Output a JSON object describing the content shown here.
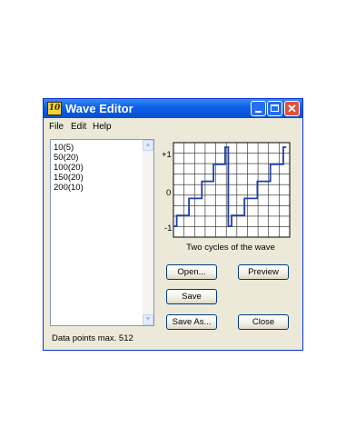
{
  "window": {
    "title": "Wave Editor",
    "app_icon": "10"
  },
  "menu": {
    "items": [
      "File",
      "Edit",
      "Help"
    ]
  },
  "list": {
    "items": [
      "10(5)",
      "50(20)",
      "100(20)",
      "150(20)",
      "200(10)"
    ]
  },
  "chart_data": {
    "type": "line",
    "title": "Two cycles of the wave",
    "y_tick_labels": [
      "+1",
      "0",
      "-1"
    ],
    "ylim": [
      -1,
      1
    ],
    "grid": true,
    "series": [
      {
        "color": "#1f3fa8",
        "x": [
          0,
          0.5,
          0.5,
          2.4,
          2.4,
          4.4,
          4.4,
          6.2,
          6.2,
          8.0,
          8.0,
          8.5,
          8.5,
          9.0,
          9.0,
          11.0,
          11.0,
          13.0,
          13.0,
          15.0,
          15.0,
          17.0,
          17.0,
          17.5
        ],
        "y": [
          -0.85,
          -0.85,
          -0.6,
          -0.6,
          -0.2,
          -0.2,
          0.2,
          0.2,
          0.6,
          0.6,
          1.0,
          1.0,
          -0.85,
          -0.85,
          -0.6,
          -0.6,
          -0.2,
          -0.2,
          0.2,
          0.2,
          0.6,
          0.6,
          1.0,
          1.0
        ]
      }
    ]
  },
  "buttons": {
    "open": "Open...",
    "preview": "Preview",
    "save": "Save",
    "save_as": "Save As...",
    "close": "Close"
  },
  "status": {
    "text": "Data points max. 512"
  },
  "colors": {
    "title_bar": "#0b5fe6",
    "window_bg": "#ece9d8",
    "wave": "#1f3fa8",
    "grid": "#000000"
  }
}
